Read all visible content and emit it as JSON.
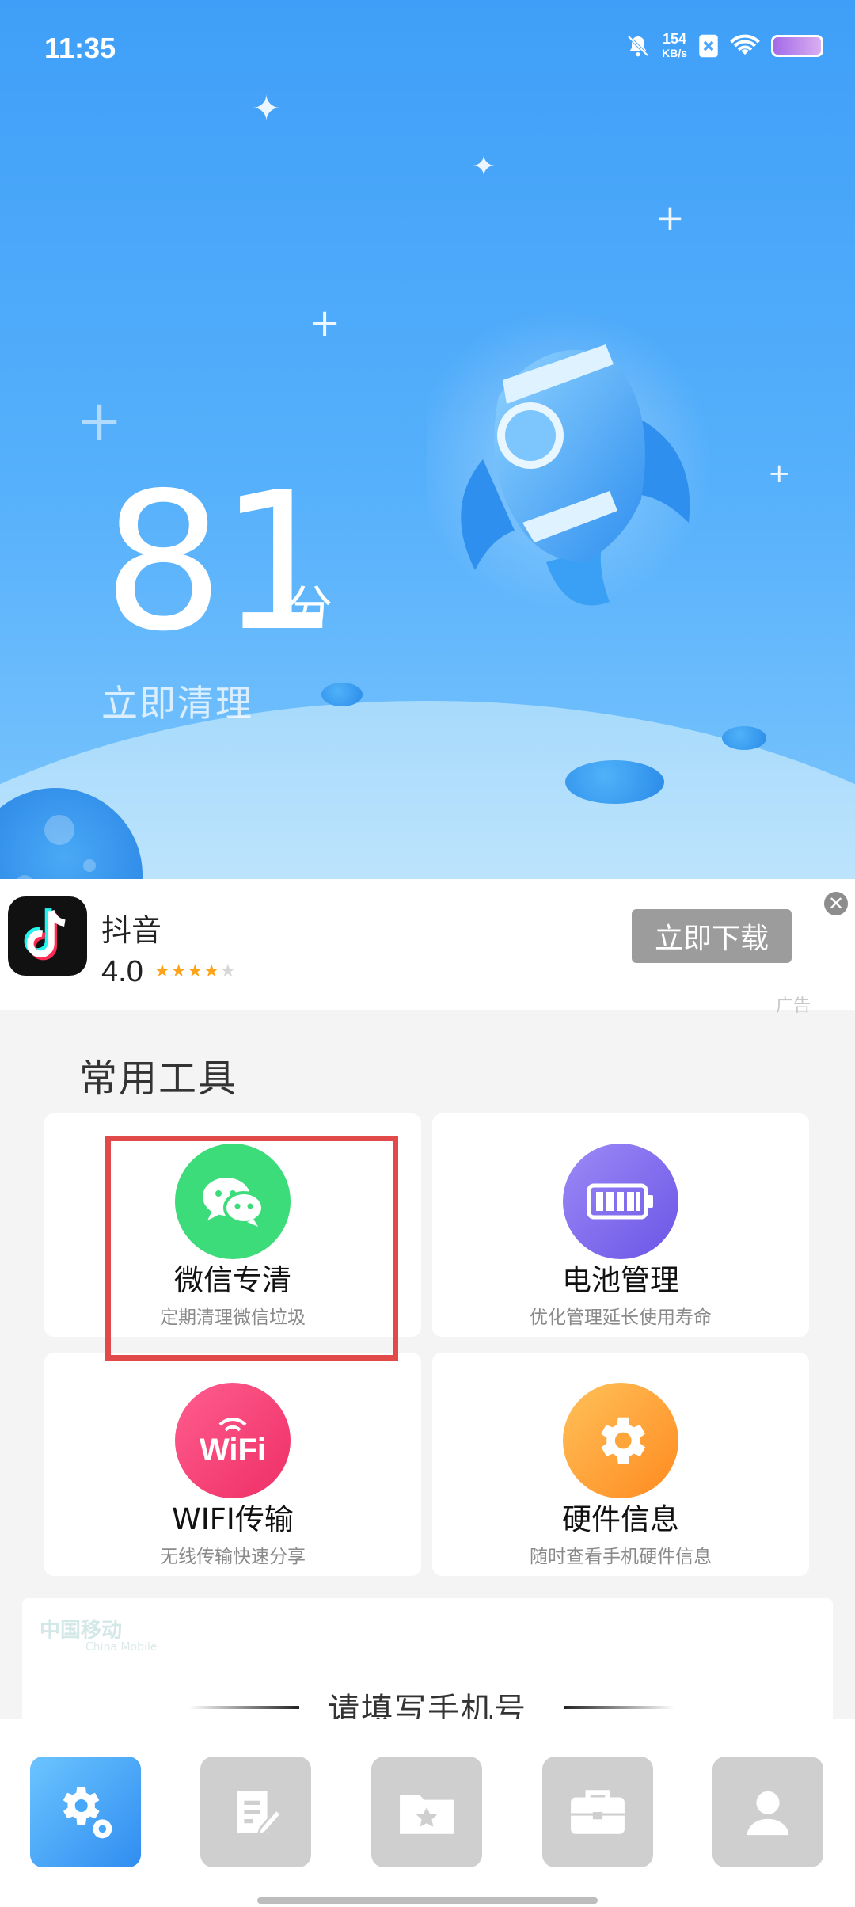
{
  "status_bar": {
    "time": "11:35",
    "net_speed_value": "154",
    "net_speed_unit": "KB/s",
    "icons": [
      "bell-muted-icon",
      "sim-x-icon",
      "wifi-icon",
      "battery-icon"
    ]
  },
  "hero": {
    "score": "81",
    "score_unit": "分",
    "action": "立即清理"
  },
  "ad": {
    "app_name": "抖音",
    "rating": "4.0",
    "stars_filled": 4,
    "stars_total": 5,
    "download_label": "立即下载",
    "close_label": "✕",
    "tag": "广告"
  },
  "tools": {
    "title": "常用工具",
    "items": [
      {
        "title": "微信专清",
        "subtitle": "定期清理微信垃圾",
        "icon": "wechat-icon",
        "color": "#3ddc7a"
      },
      {
        "title": "电池管理",
        "subtitle": "优化管理延长使用寿命",
        "icon": "battery-icon",
        "color": "#7b6bf0"
      },
      {
        "title": "WIFI传输",
        "subtitle": "无线传输快速分享",
        "icon": "wifi-badge-icon",
        "color": "#f2457a"
      },
      {
        "title": "硬件信息",
        "subtitle": "随时查看手机硬件信息",
        "icon": "gear-icon",
        "color": "#ff9f2e"
      }
    ],
    "wifi_badge_text": "WiFi"
  },
  "phone_panel": {
    "logo_text": "中国移动",
    "logo_sub": "China Mobile",
    "title": "请填写手机号"
  },
  "bottom_nav": {
    "items": [
      {
        "name": "tools",
        "icon": "gear-icon",
        "active": true
      },
      {
        "name": "notes",
        "icon": "note-icon",
        "active": false
      },
      {
        "name": "files",
        "icon": "folder-star-icon",
        "active": false
      },
      {
        "name": "toolbox",
        "icon": "briefcase-icon",
        "active": false
      },
      {
        "name": "profile",
        "icon": "user-icon",
        "active": false
      }
    ]
  },
  "colors": {
    "hero_top": "#3f9ff8",
    "accent": "#45a8fa",
    "highlight": "#e24a4a",
    "nav_inactive": "#cfcfcf"
  }
}
